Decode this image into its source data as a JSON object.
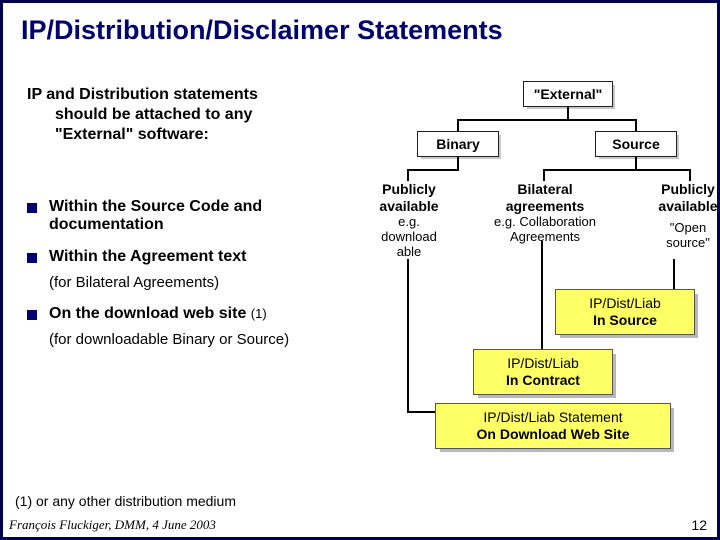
{
  "title": "IP/Distribution/Disclaimer Statements",
  "intro": {
    "line1": "IP and Distribution statements",
    "line2": "should be attached to any",
    "line3": "\"External\" software:"
  },
  "bullets": {
    "b1": "Within  the Source Code and documentation",
    "b2": "Within the Agreement text",
    "b2sub": "(for Bilateral Agreements)",
    "b3_a": "On the download web site ",
    "b3_b": "(1)",
    "b3sub": "(for downloadable Binary or Source)"
  },
  "footnote": "(1) or any other distribution medium",
  "author": "François Fluckiger, DMM, 4 June 2003",
  "pagenum": "12",
  "tree": {
    "root": "\"External\"",
    "binary": "Binary",
    "source": "Source",
    "pub1_l1": "Publicly",
    "pub1_l2": "available",
    "pub1_l3": "e.g.",
    "pub1_l4": "download",
    "pub1_l5": "able",
    "bilat_l1": "Bilateral",
    "bilat_l2": "agreements",
    "bilat_l3": "e.g. Collaboration",
    "bilat_l4": "Agreements",
    "pub2_l1": "Publicly",
    "pub2_l2": "available",
    "pub2_l3": "\"Open",
    "pub2_l4": "source\""
  },
  "callouts": {
    "src_l1": "IP/Dist/Liab",
    "src_l2": "In Source",
    "con_l1": "IP/Dist/Liab",
    "con_l2": "In Contract",
    "web_l1": "IP/Dist/Liab Statement",
    "web_l2": "On Download Web Site"
  }
}
